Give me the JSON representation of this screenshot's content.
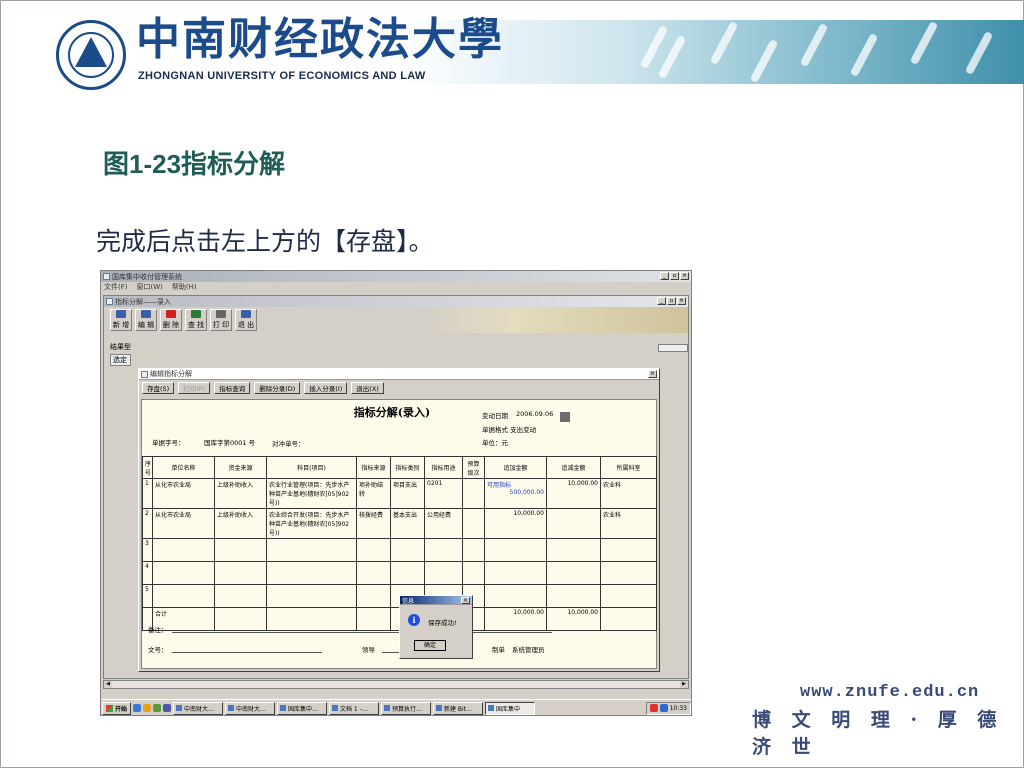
{
  "slide": {
    "title": "图1-23指标分解",
    "instruction": "完成后点击左上方的【存盘】。",
    "footer_url": "www.znufe.edu.cn",
    "footer_motto": "博 文 明 理 · 厚 德 济 世"
  },
  "header": {
    "university_cn": "中南财经政法大學",
    "university_en": "ZHONGNAN UNIVERSITY OF ECONOMICS AND LAW"
  },
  "app": {
    "window_title": "国库集中收付管理系统",
    "menu": [
      "文件(F)",
      "窗口(W)",
      "帮助(H)"
    ],
    "child_title": "指标分解——录入",
    "toolbar": [
      {
        "label": "新 增",
        "icon": "new-icon",
        "color": "#3a5fa8"
      },
      {
        "label": "编 辑",
        "icon": "edit-icon",
        "color": "#3a5fa8"
      },
      {
        "label": "删 除",
        "icon": "delete-icon",
        "color": "#d02020"
      },
      {
        "label": "查 找",
        "icon": "find-icon",
        "color": "#2a7a3a"
      },
      {
        "label": "打 印",
        "icon": "print-icon",
        "color": "#666666"
      },
      {
        "label": "退 出",
        "icon": "exit-icon",
        "color": "#3a5fa8"
      }
    ],
    "result_label": "结果型",
    "result_sub": "选定",
    "dialog_title": "编辑指标分解",
    "dialog_buttons": [
      {
        "label": "存盘(S)",
        "disabled": false
      },
      {
        "label": "打印(P)",
        "disabled": true
      },
      {
        "label": "指标查询",
        "disabled": false
      },
      {
        "label": "删除分录(D)",
        "disabled": false
      },
      {
        "label": "插入分录(I)",
        "disabled": false
      },
      {
        "label": "退出(X)",
        "disabled": false
      }
    ],
    "form": {
      "title": "指标分解(录入)",
      "change_date_label": "变动日期",
      "change_date": "2006.09.06",
      "doc_format": "单据格式 支出变动",
      "unit": "单位：元",
      "doc_no_label": "单据字号：",
      "doc_no": "国库字第0001 号",
      "offset_no_label": "对冲单号：",
      "columns": [
        "序号",
        "单位名称",
        "资金来源",
        "科目(项目)",
        "指标来源",
        "指标类别",
        "指标用途",
        "预算级次",
        "追加金额",
        "追减金额",
        "所属科室"
      ],
      "rows": [
        {
          "no": "1",
          "unit": "从化市农业局",
          "fund": "上级补助收入",
          "subject": "农业行业管理(项目：先步水产种苗产业基地(穗财农[05]902号))",
          "source": "项补助结转",
          "category": "项目支出",
          "purpose": "0201",
          "level": "",
          "add_hint": "可用指标",
          "add_amount": "500,000.00",
          "sub_amount": "10,000.00",
          "dept": "农业科"
        },
        {
          "no": "2",
          "unit": "从化市农业局",
          "fund": "上级补助收入",
          "subject": "农业综合开发(项目：先步水产种苗产业基地(穗财农[05]902号))",
          "source": "核拨经费",
          "category": "基本支出",
          "purpose": "公用经费",
          "level": "",
          "add_hint": "",
          "add_amount": "10,000.00",
          "sub_amount": "",
          "dept": "农业科"
        },
        {
          "no": "3"
        },
        {
          "no": "4"
        },
        {
          "no": "5"
        }
      ],
      "total_label": "合计",
      "total_add": "10,000.00",
      "total_sub": "10,000.00",
      "remark_label": "备注：",
      "doc_label": "文号：",
      "leader_label": "领导",
      "maker_label": "制单",
      "maker": "系统管理员"
    },
    "message_box": {
      "title": "信息",
      "text": "保存成功!",
      "ok": "确定"
    },
    "taskbar": {
      "start": "开始",
      "tasks": [
        {
          "label": "中南财大…",
          "active": false
        },
        {
          "label": "中南财大…",
          "active": false
        },
        {
          "label": "国库集中…",
          "active": false
        },
        {
          "label": "文档 1 -…",
          "active": false
        },
        {
          "label": "预算执行…",
          "active": false
        },
        {
          "label": "新建 Bit…",
          "active": false
        },
        {
          "label": "国库集中",
          "active": true
        }
      ],
      "clock": "10:33"
    }
  }
}
